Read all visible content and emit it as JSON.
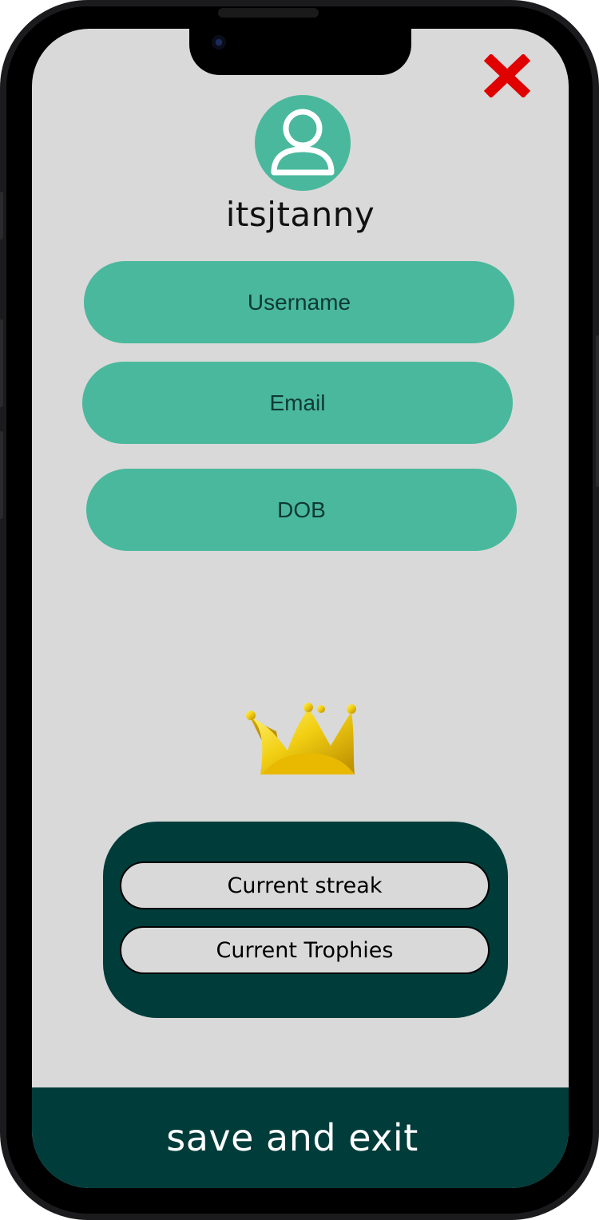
{
  "profile": {
    "display_name": "itsjtanny",
    "avatar_icon": "user-icon"
  },
  "close": {
    "icon": "close-icon",
    "color": "#e00000"
  },
  "fields": {
    "username_label": "Username",
    "email_label": "Email",
    "dob_label": "DOB"
  },
  "badge": {
    "icon": "crown-icon"
  },
  "stats": {
    "streak_label": "Current streak",
    "trophies_label": "Current Trophies"
  },
  "footer": {
    "save_label": "save and exit"
  },
  "colors": {
    "accent": "#4ab89c",
    "dark": "#003c3a",
    "background": "#d9d9d9"
  }
}
